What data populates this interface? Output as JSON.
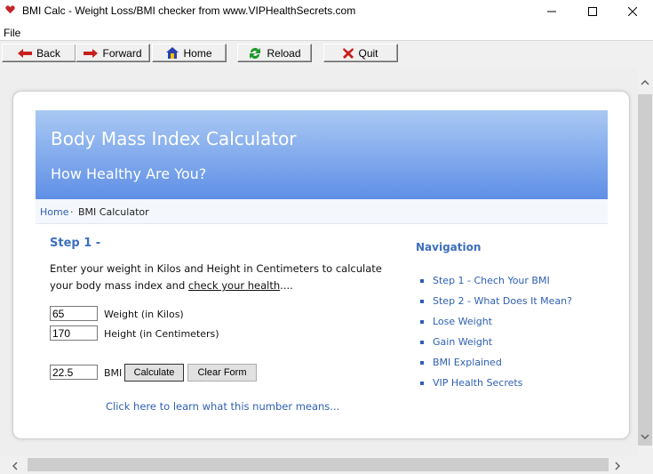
{
  "window": {
    "title": "BMI Calc - Weight Loss/BMI checker from www.VIPHealthSecrets.com",
    "minimize": "—",
    "maximize": "☐",
    "close": "✕"
  },
  "menu": {
    "file": "File"
  },
  "toolbar": {
    "back": "Back",
    "forward": "Forward",
    "home": "Home",
    "reload": "Reload",
    "quit": "Quit"
  },
  "banner": {
    "title": "Body Mass Index Calculator",
    "subtitle": "How Healthy Are You?"
  },
  "breadcrumb": {
    "home": "Home",
    "separator": "·",
    "current": "BMI Calculator"
  },
  "step": {
    "heading": "Step 1 -",
    "intro_text": "Enter your weight in Kilos and Height in Centimeters to calculate your body mass index and ",
    "intro_link": "check your health",
    "intro_end": "...."
  },
  "form": {
    "weight_value": "65",
    "weight_label": "Weight (in Kilos)",
    "height_value": "170",
    "height_label": "Height (in Centimeters)",
    "bmi_value": "22.5",
    "bmi_label": "BMI",
    "calculate": "Calculate",
    "clear": "Clear Form"
  },
  "meaning_link": "Click here to learn what this number means...",
  "navigation": {
    "heading": "Navigation",
    "items": [
      "Step 1 - Chech Your BMI",
      "Step 2 - What Does It Mean?",
      "Lose Weight",
      "Gain Weight",
      "BMI Explained",
      "VIP Health Secrets"
    ]
  },
  "colors": {
    "accent": "#3c6fbf",
    "link": "#2f5fb3",
    "banner_top": "#a9c8f3",
    "banner_bottom": "#5f8fe6"
  }
}
